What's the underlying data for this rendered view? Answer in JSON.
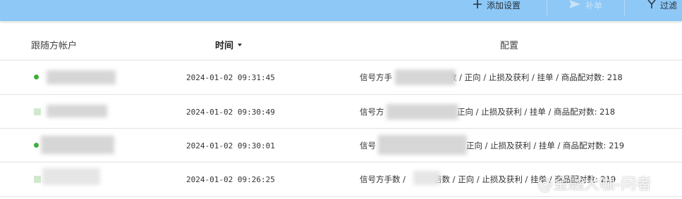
{
  "toolbar": {
    "add_settings_label": "添加设置",
    "reissue_label": "补单",
    "filter_label": "过滤"
  },
  "table": {
    "columns": {
      "account": "跟随方帐户",
      "time": "时间",
      "config": "配置"
    },
    "rows": [
      {
        "status": "dot",
        "time": "2024-01-02 09:31:45",
        "config_left": "信号方手",
        "config_right": "数 / 正向 / 止损及获利 / 挂单 / 商品配对数: 218"
      },
      {
        "status": "square",
        "time": "2024-01-02 09:30:49",
        "config_left": "信号方",
        "config_right": "/ 正向 / 止损及获利 / 挂单 / 商品配对数: 218"
      },
      {
        "status": "dot",
        "time": "2024-01-02 09:30:01",
        "config_left": "信号",
        "config_right": "正向 / 止损及获利 / 挂单 / 商品配对数: 219"
      },
      {
        "status": "square",
        "time": "2024-01-02 09:26:25",
        "config_left": "信号方手数 /",
        "config_right": "倍数 / 正向 / 止损及获利 / 挂单 / 商品配对数: 219"
      }
    ]
  },
  "watermark": "@金融大咖-问者",
  "colors": {
    "toolbar_bg": "#8ec8f6",
    "status_green": "#3dae3d"
  },
  "icons": {
    "add": "plus-icon",
    "reissue": "send-icon",
    "filter": "funnel-icon"
  }
}
